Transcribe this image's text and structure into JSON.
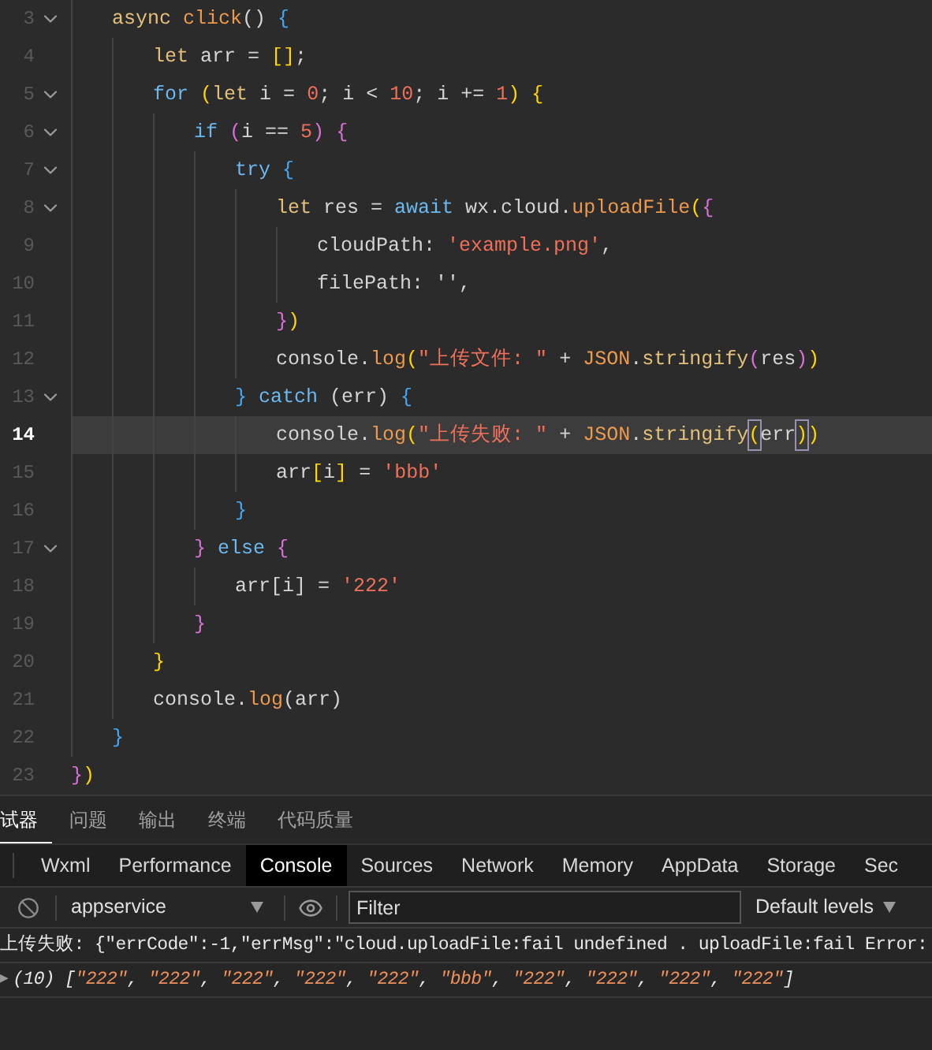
{
  "editor": {
    "lines": [
      {
        "number": "3",
        "foldable": true,
        "selected": false,
        "tokens": [
          {
            "text": "async ",
            "kind": "kw2"
          },
          {
            "text": "click",
            "kind": "fn"
          },
          {
            "text": "() ",
            "kind": "plain"
          },
          {
            "text": "{",
            "kind": "b3"
          }
        ],
        "children": [
          {
            "number": "4",
            "foldable": false,
            "selected": false,
            "tokens": [
              {
                "text": "let",
                "kind": "kw2"
              },
              {
                "text": " arr = ",
                "kind": "plain"
              },
              {
                "text": "[]",
                "kind": "b1"
              },
              {
                "text": ";",
                "kind": "plain"
              }
            ]
          },
          {
            "number": "5",
            "foldable": true,
            "selected": false,
            "tokens": [
              {
                "text": "for ",
                "kind": "kw"
              },
              {
                "text": "(",
                "kind": "b1"
              },
              {
                "text": "let",
                "kind": "kw2"
              },
              {
                "text": " i = ",
                "kind": "plain"
              },
              {
                "text": "0",
                "kind": "num"
              },
              {
                "text": "; i < ",
                "kind": "plain"
              },
              {
                "text": "10",
                "kind": "num"
              },
              {
                "text": "; i += ",
                "kind": "plain"
              },
              {
                "text": "1",
                "kind": "num"
              },
              {
                "text": ") {",
                "kind": "b1"
              }
            ],
            "children": [
              {
                "number": "6",
                "foldable": true,
                "selected": false,
                "tokens": [
                  {
                    "text": "if ",
                    "kind": "kw"
                  },
                  {
                    "text": "(",
                    "kind": "b2"
                  },
                  {
                    "text": "i == ",
                    "kind": "plain"
                  },
                  {
                    "text": "5",
                    "kind": "num"
                  },
                  {
                    "text": ") {",
                    "kind": "b2"
                  }
                ],
                "children": [
                  {
                    "number": "7",
                    "foldable": true,
                    "selected": false,
                    "tokens": [
                      {
                        "text": "try ",
                        "kind": "kw"
                      },
                      {
                        "text": "{",
                        "kind": "b3"
                      }
                    ],
                    "children": [
                      {
                        "number": "8",
                        "foldable": true,
                        "selected": false,
                        "tokens": [
                          {
                            "text": "let",
                            "kind": "kw2"
                          },
                          {
                            "text": " res = ",
                            "kind": "plain"
                          },
                          {
                            "text": "await",
                            "kind": "kw"
                          },
                          {
                            "text": " wx.cloud.",
                            "kind": "plain"
                          },
                          {
                            "text": "uploadFile",
                            "kind": "fn"
                          },
                          {
                            "text": "(",
                            "kind": "b1"
                          },
                          {
                            "text": "{",
                            "kind": "b2"
                          }
                        ],
                        "children": [
                          {
                            "number": "9",
                            "foldable": false,
                            "selected": false,
                            "tokens": [
                              {
                                "text": "cloudPath: ",
                                "kind": "plain"
                              },
                              {
                                "text": "'example.png'",
                                "kind": "str"
                              },
                              {
                                "text": ",",
                                "kind": "plain"
                              }
                            ]
                          },
                          {
                            "number": "10",
                            "foldable": false,
                            "selected": false,
                            "tokens": [
                              {
                                "text": "filePath: '',",
                                "kind": "plain"
                              }
                            ]
                          }
                        ]
                      },
                      {
                        "number": "11",
                        "foldable": false,
                        "selected": false,
                        "tokens": [
                          {
                            "text": "}",
                            "kind": "b2"
                          },
                          {
                            "text": ")",
                            "kind": "b1"
                          }
                        ]
                      },
                      {
                        "number": "12",
                        "foldable": false,
                        "selected": false,
                        "tokens": [
                          {
                            "text": "console.",
                            "kind": "plain"
                          },
                          {
                            "text": "log",
                            "kind": "fn"
                          },
                          {
                            "text": "(",
                            "kind": "b1"
                          },
                          {
                            "text": "\"上传文件: \"",
                            "kind": "str"
                          },
                          {
                            "text": " + ",
                            "kind": "plain"
                          },
                          {
                            "text": "JSON",
                            "kind": "fn"
                          },
                          {
                            "text": ".",
                            "kind": "plain"
                          },
                          {
                            "text": "stringify",
                            "kind": "kw2"
                          },
                          {
                            "text": "(",
                            "kind": "b2"
                          },
                          {
                            "text": "res",
                            "kind": "plain"
                          },
                          {
                            "text": ")",
                            "kind": "b2"
                          },
                          {
                            "text": ")",
                            "kind": "b1"
                          }
                        ]
                      }
                    ]
                  },
                  {
                    "number": "13",
                    "foldable": true,
                    "selected": false,
                    "tokens": [
                      {
                        "text": "} ",
                        "kind": "b3"
                      },
                      {
                        "text": "catch",
                        "kind": "kw"
                      },
                      {
                        "text": " (err) ",
                        "kind": "plain"
                      },
                      {
                        "text": "{",
                        "kind": "b3"
                      }
                    ],
                    "children": [
                      {
                        "number": "14",
                        "foldable": false,
                        "selected": true,
                        "tokens": [
                          {
                            "text": "console.",
                            "kind": "plain"
                          },
                          {
                            "text": "log",
                            "kind": "fn"
                          },
                          {
                            "text": "(",
                            "kind": "b1"
                          },
                          {
                            "text": "\"上传失败: \"",
                            "kind": "str"
                          },
                          {
                            "text": " + ",
                            "kind": "plain"
                          },
                          {
                            "text": "JSON",
                            "kind": "fn"
                          },
                          {
                            "text": ".",
                            "kind": "plain"
                          },
                          {
                            "text": "stringify",
                            "kind": "kw2"
                          },
                          {
                            "text": "(",
                            "kind": "match"
                          },
                          {
                            "text": "err",
                            "kind": "plain"
                          },
                          {
                            "text": ")",
                            "kind": "match"
                          },
                          {
                            "text": ")",
                            "kind": "b1"
                          }
                        ]
                      },
                      {
                        "number": "15",
                        "foldable": false,
                        "selected": false,
                        "tokens": [
                          {
                            "text": "arr",
                            "kind": "plain"
                          },
                          {
                            "text": "[",
                            "kind": "b1"
                          },
                          {
                            "text": "i",
                            "kind": "plain"
                          },
                          {
                            "text": "]",
                            "kind": "b1"
                          },
                          {
                            "text": " = ",
                            "kind": "plain"
                          },
                          {
                            "text": "'bbb'",
                            "kind": "str"
                          }
                        ]
                      }
                    ]
                  },
                  {
                    "number": "16",
                    "foldable": false,
                    "selected": false,
                    "tokens": [
                      {
                        "text": "}",
                        "kind": "b3"
                      }
                    ]
                  }
                ]
              },
              {
                "number": "17",
                "foldable": true,
                "selected": false,
                "tokens": [
                  {
                    "text": "} ",
                    "kind": "b2"
                  },
                  {
                    "text": "else",
                    "kind": "kw"
                  },
                  {
                    "text": " {",
                    "kind": "b2"
                  }
                ],
                "children": [
                  {
                    "number": "18",
                    "foldable": false,
                    "selected": false,
                    "tokens": [
                      {
                        "text": "arr[i] = ",
                        "kind": "plain"
                      },
                      {
                        "text": "'222'",
                        "kind": "str"
                      }
                    ]
                  }
                ]
              },
              {
                "number": "19",
                "foldable": false,
                "selected": false,
                "tokens": [
                  {
                    "text": "}",
                    "kind": "b2"
                  }
                ]
              }
            ]
          },
          {
            "number": "20",
            "foldable": false,
            "selected": false,
            "tokens": [
              {
                "text": "}",
                "kind": "b1"
              }
            ]
          },
          {
            "number": "21",
            "foldable": false,
            "selected": false,
            "tokens": [
              {
                "text": "console.",
                "kind": "plain"
              },
              {
                "text": "log",
                "kind": "fn"
              },
              {
                "text": "(arr)",
                "kind": "plain"
              }
            ]
          }
        ]
      },
      {
        "number": "22",
        "foldable": false,
        "selected": false,
        "tokens": [
          {
            "text": "}",
            "kind": "b3"
          }
        ]
      }
    ],
    "closing_line": {
      "number": "23",
      "foldable": false,
      "selected": false,
      "tokens": [
        {
          "text": "}",
          "kind": "b2"
        },
        {
          "text": ")",
          "kind": "b1"
        }
      ]
    }
  },
  "panel_tabs": [
    {
      "label": "试器",
      "selected": true
    },
    {
      "label": "问题",
      "selected": false
    },
    {
      "label": "输出",
      "selected": false
    },
    {
      "label": "终端",
      "selected": false
    },
    {
      "label": "代码质量",
      "selected": false
    }
  ],
  "devtools_tabs": [
    {
      "label": "Wxml",
      "selected": false
    },
    {
      "label": "Performance",
      "selected": false
    },
    {
      "label": "Console",
      "selected": true
    },
    {
      "label": "Sources",
      "selected": false
    },
    {
      "label": "Network",
      "selected": false
    },
    {
      "label": "Memory",
      "selected": false
    },
    {
      "label": "AppData",
      "selected": false
    },
    {
      "label": "Storage",
      "selected": false
    },
    {
      "label": "Sec",
      "selected": false
    }
  ],
  "toolbar": {
    "context": "appservice",
    "filter": {
      "placeholder": "Filter"
    },
    "levels": "Default levels"
  },
  "console": [
    {
      "kind": "log",
      "tokens": [
        {
          "text": "上传失败: {\"errCode\":-1,\"errMsg\":\"cloud.uploadFile:fail undefined . uploadFile:fail Error:",
          "kind": "plain"
        }
      ]
    },
    {
      "kind": "array",
      "expander": "▶",
      "tokens": [
        {
          "text": "(10) [",
          "kind": "plain"
        },
        {
          "text": "\"222\"",
          "kind": "str"
        },
        {
          "text": ", ",
          "kind": "plain"
        },
        {
          "text": "\"222\"",
          "kind": "str"
        },
        {
          "text": ", ",
          "kind": "plain"
        },
        {
          "text": "\"222\"",
          "kind": "str"
        },
        {
          "text": ", ",
          "kind": "plain"
        },
        {
          "text": "\"222\"",
          "kind": "str"
        },
        {
          "text": ", ",
          "kind": "plain"
        },
        {
          "text": "\"222\"",
          "kind": "str"
        },
        {
          "text": ", ",
          "kind": "plain"
        },
        {
          "text": "\"bbb\"",
          "kind": "str"
        },
        {
          "text": ", ",
          "kind": "plain"
        },
        {
          "text": "\"222\"",
          "kind": "str"
        },
        {
          "text": ", ",
          "kind": "plain"
        },
        {
          "text": "\"222\"",
          "kind": "str"
        },
        {
          "text": ", ",
          "kind": "plain"
        },
        {
          "text": "\"222\"",
          "kind": "str"
        },
        {
          "text": ", ",
          "kind": "plain"
        },
        {
          "text": "\"222\"",
          "kind": "str"
        },
        {
          "text": "]",
          "kind": "plain"
        }
      ]
    }
  ]
}
